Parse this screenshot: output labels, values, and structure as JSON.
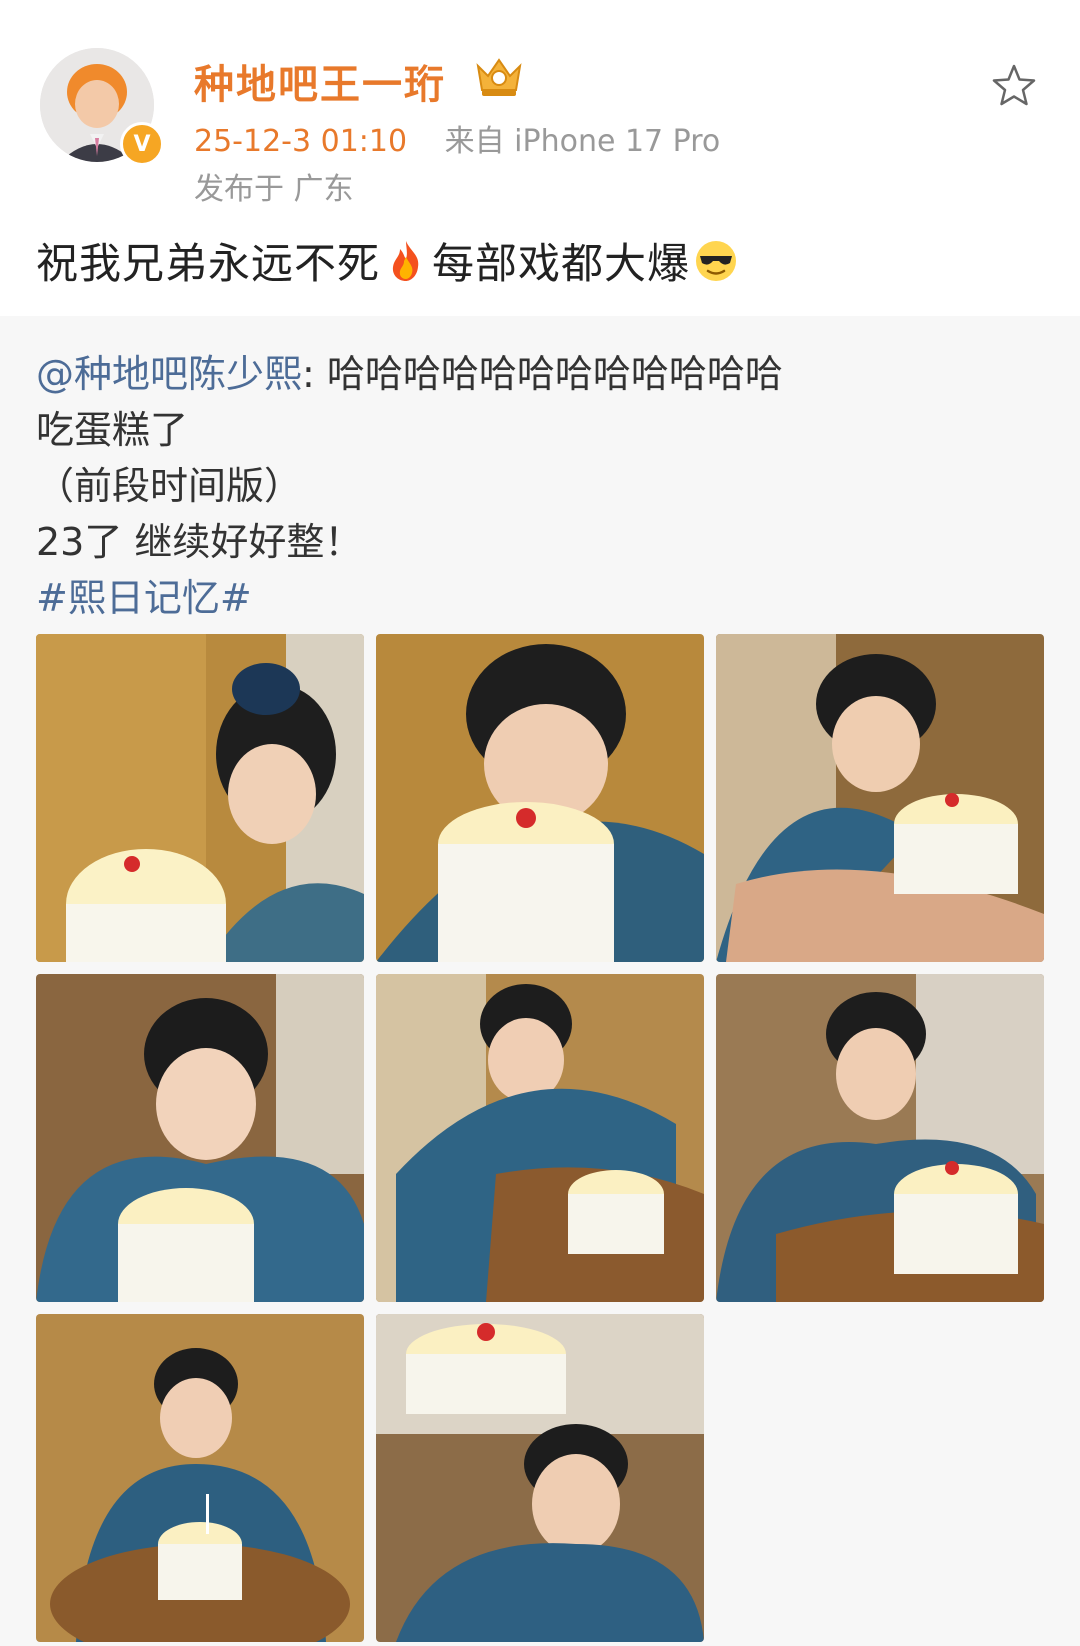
{
  "post": {
    "author": "种地吧王一珩",
    "time": "25-12-3 01:10",
    "source": "来自 iPhone 17 Pro",
    "location": "发布于 广东",
    "text_part1": "祝我兄弟永远不死",
    "text_part2": "每部戏都大爆",
    "icons": {
      "avatar": "avatar-image",
      "verified": "verified-badge-icon",
      "crown": "crown-badge-icon",
      "favorite": "star-outline-icon",
      "fire": "fire-emoji-icon",
      "cool": "sunglasses-emoji-icon"
    }
  },
  "repost": {
    "mention": "@种地吧陈少熙",
    "line1_rest": ": 哈哈哈哈哈哈哈哈哈哈哈哈",
    "line2": "吃蛋糕了",
    "line3": "（前段时间版）",
    "line4": "23了 继续好好整！",
    "topic": "#熙日记忆#"
  },
  "photos": [
    {
      "desc": "birthday-photo-1"
    },
    {
      "desc": "birthday-photo-2"
    },
    {
      "desc": "birthday-photo-3"
    },
    {
      "desc": "birthday-photo-4"
    },
    {
      "desc": "birthday-photo-5"
    },
    {
      "desc": "birthday-photo-6"
    },
    {
      "desc": "birthday-photo-7"
    },
    {
      "desc": "birthday-photo-8"
    }
  ],
  "colors": {
    "accent": "#e8792b",
    "link": "#4d6c97",
    "meta": "#999999"
  }
}
